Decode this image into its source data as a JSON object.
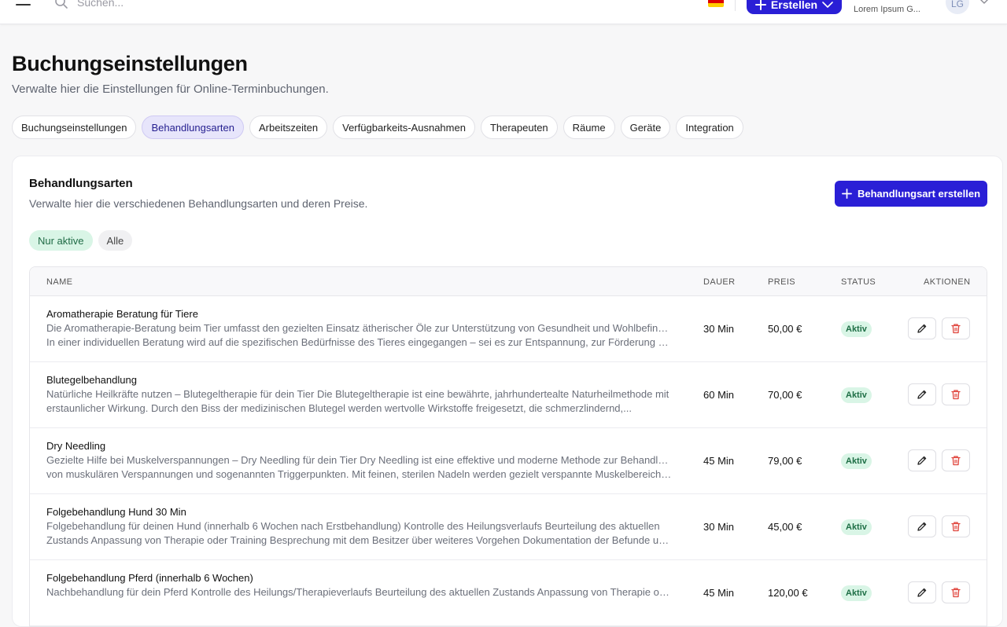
{
  "topbar": {
    "search_placeholder": "Suchen...",
    "create_label": "Erstellen",
    "company_name": "Lorem Ipsum G...",
    "avatar_initials": "LG"
  },
  "header": {
    "title": "Buchungseinstellungen",
    "subtitle": "Verwalte hier die Einstellungen für Online-Terminbuchungen."
  },
  "tabs": [
    {
      "label": "Buchungseinstellungen"
    },
    {
      "label": "Behandlungsarten"
    },
    {
      "label": "Arbeitszeiten"
    },
    {
      "label": "Verfügbarkeits-Ausnahmen"
    },
    {
      "label": "Therapeuten"
    },
    {
      "label": "Räume"
    },
    {
      "label": "Geräte"
    },
    {
      "label": "Integration"
    }
  ],
  "active_tab": "Behandlungsarten",
  "section": {
    "title": "Behandlungsarten",
    "subtitle": "Verwalte hier die verschiedenen Behandlungsarten und deren Preise.",
    "create_label": "Behandlungsart erstellen",
    "filters": [
      {
        "label": "Nur aktive"
      },
      {
        "label": "Alle"
      }
    ]
  },
  "table": {
    "headers": {
      "name": "NAME",
      "duration": "DAUER",
      "price": "PREIS",
      "status": "STATUS",
      "actions": "AKTIONEN"
    },
    "rows": [
      {
        "name": "Aromatherapie Beratung für Tiere",
        "desc1": "Die Aromatherapie-Beratung beim Tier umfasst den gezielten Einsatz ätherischer Öle zur Unterstützung von Gesundheit und Wohlbefinden.",
        "desc2": "In einer individuellen Beratung wird auf die spezifischen Bedürfnisse des Tieres eingegangen – sei es zur Entspannung, zur Förderung der...",
        "duration": "30 Min",
        "price": "50,00 €",
        "status": "Aktiv"
      },
      {
        "name": "Blutegelbehandlung",
        "desc1": "Natürliche Heilkräfte nutzen – Blutegeltherapie für dein Tier Die Blutegeltherapie ist eine bewährte, jahrhundertealte Naturheilmethode mit",
        "desc2": "erstaunlicher Wirkung. Durch den Biss der medizinischen Blutegel werden wertvolle Wirkstoffe freigesetzt, die schmerzlindernd,...",
        "duration": "60 Min",
        "price": "70,00 €",
        "status": "Aktiv"
      },
      {
        "name": "Dry Needling",
        "desc1": "Gezielte Hilfe bei Muskelverspannungen – Dry Needling für dein Tier Dry Needling ist eine effektive und moderne Methode zur Behandlung",
        "desc2": "von muskulären Verspannungen und sogenannten Triggerpunkten. Mit feinen, sterilen Nadeln werden gezielt verspannte Muskelbereiche...",
        "duration": "45 Min",
        "price": "79,00 €",
        "status": "Aktiv"
      },
      {
        "name": "Folgebehandlung Hund 30 Min",
        "desc1": "Folgebehandlung für deinen Hund (innerhalb 6 Wochen nach Erstbehandlung) Kontrolle des Heilungsverlaufs Beurteilung des aktuellen",
        "desc2": "Zustands Anpassung von Therapie oder Training Besprechung mit dem Besitzer über weiteres Vorgehen Dokumentation der Befunde und...",
        "duration": "30 Min",
        "price": "45,00 €",
        "status": "Aktiv"
      },
      {
        "name": "Folgebehandlung Pferd (innerhalb 6 Wochen)",
        "desc1": "Nachbehandlung für dein Pferd Kontrolle des Heilungs/Therapieverlaufs Beurteilung des aktuellen Zustands Anpassung von Therapie oder",
        "desc2": "",
        "duration": "45 Min",
        "price": "120,00 €",
        "status": "Aktiv"
      }
    ]
  },
  "colors": {
    "primary": "#2a1fd6",
    "active_tab_bg": "#e7e5fb",
    "status_bg": "#d9f5e6",
    "status_text": "#1d6e45",
    "delete_icon": "#e0443c"
  },
  "icons": {
    "menu": "hamburger-menu-icon",
    "search": "search-icon",
    "flag": "german-flag-icon",
    "plus": "plus-icon",
    "chevron": "chevron-down-icon",
    "edit": "pencil-icon",
    "delete": "trash-icon"
  }
}
